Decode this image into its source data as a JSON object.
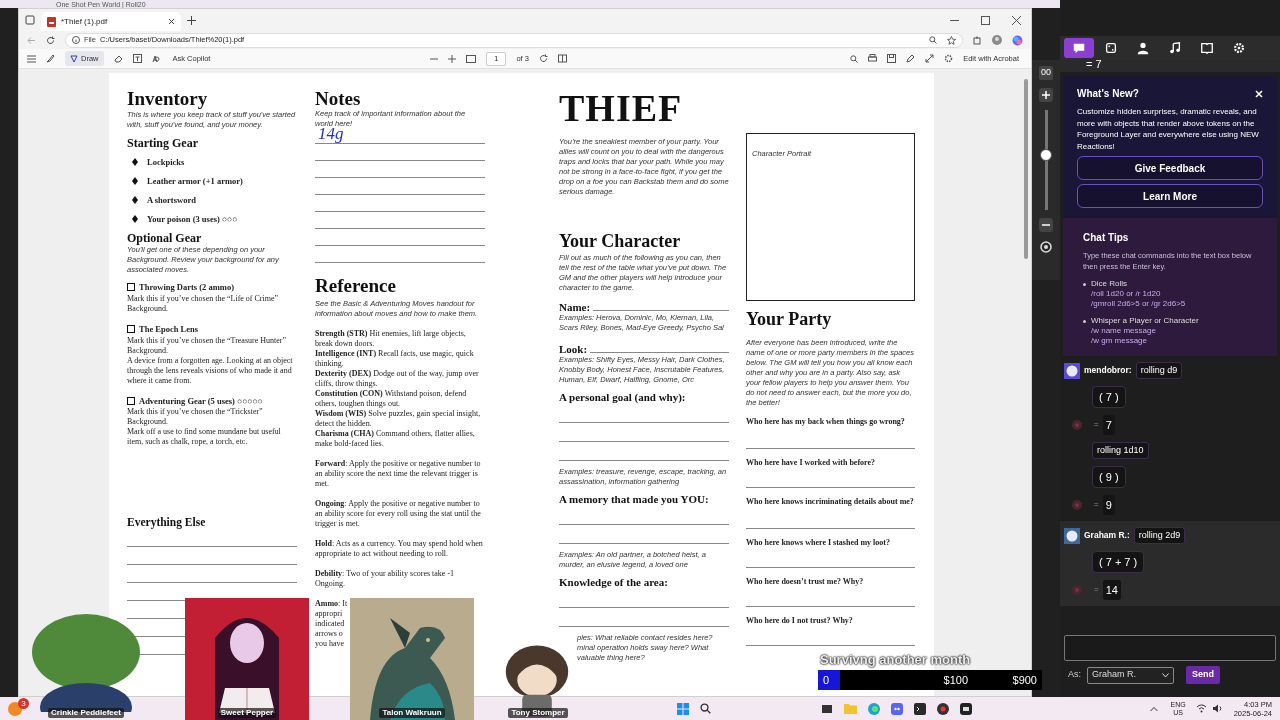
{
  "back_window": {
    "tab_title": "One Shot Pen World | Roll20"
  },
  "browser": {
    "tab_title": "*Thief (1).pdf",
    "address_label": "File",
    "address": "C:/Users/baset/Downloads/Thief%20(1).pdf"
  },
  "pdf_toolbar": {
    "draw_label": "Draw",
    "copilot_label": "Ask Copilot",
    "page": "1",
    "page_count": "of 3",
    "acrobat_label": "Edit with Acrobat"
  },
  "inventory": {
    "title": "Inventory",
    "intro": "This is where you keep track of stuff you've started with, stuff you've found, and your money.",
    "starting_title": "Starting Gear",
    "starting_items": [
      "Lockpicks",
      "Leather armor (+1 armor)",
      "A shortsword",
      "Your poison (3 uses) ○○○"
    ],
    "optional_title": "Optional Gear",
    "optional_intro": "You'll get one of these depending on your Background. Review your background for any associated moves.",
    "optional_items": [
      {
        "name": "Throwing Darts (2 ammo)",
        "checked": false,
        "text": [
          "Mark this if you’ve chosen the “Life of Crime” Background."
        ]
      },
      {
        "name": "The Epoch Lens",
        "checked": false,
        "text": [
          "Mark this if you’ve chosen the “Treasure Hunter” Background.",
          "A device from a forgotten age. Looking at an object through the lens reveals visions of who made it and where it came from."
        ]
      },
      {
        "name": "Adventuring Gear (5 uses) ○○○○○",
        "checked": false,
        "text": [
          "Mark this if you’ve chosen the “Trickster” Background.",
          "Mark off a use to find some mundane but useful item, such as chalk, rope, a torch, etc."
        ]
      }
    ],
    "else_title": "Everything Else"
  },
  "notes": {
    "title": "Notes",
    "intro": "Keep track of important information about the world here!",
    "handwriting": "14g"
  },
  "reference": {
    "title": "Reference",
    "intro": "See the Basic & Adventuring Moves handout for information about moves and how to make them.",
    "stats": [
      "**Strength (STR)** Hit enemies, lift large objects, break down doors.",
      "**Intelligence (INT)** Recall facts, use magic, quick thinking.",
      "**Dexterity (DEX)** Dodge out of the way, jump over cliffs, throw things.",
      "**Constitution (CON)** Withstand poison, defend others, toughen things out.",
      "**Wisdom (WIS)** Solve puzzles, gain special insight, detect the hidden.",
      "**Charisma (CHA)** Command others, flatter allies, make bold-faced lies."
    ],
    "terms": [
      "**Forward**: Apply the positive or negative number to an ability score the next time the relevant trigger is met.",
      "**Ongoing**: Apply the positive or negative number to an ability score for every roll using the stat until the trigger is met.",
      "**Hold**: Acts as a currency. You may spend hold when appropriate to act without needing to roll.",
      "**Debility**: Two of your ability scores take -1 Ongoing."
    ],
    "ammo_lines": [
      "**Ammo**: It",
      "appropri",
      "indicated",
      "arrows o",
      "you have"
    ]
  },
  "character": {
    "title": "THIEF",
    "intro": "You’re the sneakiest member of your party. Your allies will count on you to deal with the dangerous traps and locks that bar your path. While you may not be strong in a face-to-face fight, if you get the drop on a foe you can Backstab them and do some serious damage.",
    "section_title": "Your Character",
    "section_intro": "Fill out as much of the following as you can, then tell the rest of the table what you’ve put down. The GM and the other players will help introduce your character to the game.",
    "fields": [
      {
        "kind": "inline",
        "label": "Name:",
        "examples": [
          "Examples: Herova, Dominic, Mo, Kiernan, Lila, Scars Riley, Bones, Mad-Eye Greedy, Psycho Sal"
        ]
      },
      {
        "kind": "inline",
        "label": "Look:",
        "examples": [
          "Examples: Shifty Eyes, Messy Hair, Dark Clothes, Knobby Body, Honest Face, Inscrutable Features, Human, Elf, Dwarf, Halfling, Gnome, Orc"
        ]
      },
      {
        "kind": "long",
        "label": "A personal goal (and why):",
        "examples": [
          "Examples: treasure, revenge, escape, tracking, an assassination, information gathering"
        ]
      },
      {
        "kind": "short",
        "label": "A memory that made you YOU:",
        "examples": [
          "Examples: An old partner, a botched heist, a murder, an elusive legend, a loved one"
        ]
      },
      {
        "kind": "short",
        "label": "Knowledge of the area:",
        "examples": [
          "ples: What reliable contact resides here?",
          "minal operation holds sway here? What",
          "valuable thing here?"
        ]
      }
    ]
  },
  "party": {
    "portrait_label": "Character Portrait",
    "title": "Your Party",
    "intro": "After everyone has been introduced, write the name of one or more party members in the spaces below. The GM will tell you how you all know each other and why you are in a party. Also say, ask your fellow players to help you answer them. You do not need to answer each, but the more you do, the better!",
    "questions": [
      "Who here has my back when things go wrong?",
      "Who here have I worked with before?",
      "Who here knows incriminating details about me?",
      "Who here knows where I stashed my loot?",
      "Who here doesn’t trust me? Why?",
      "Who here do I not trust? Why?"
    ]
  },
  "vtt": {
    "zoom": {
      "fragment": "00",
      "level": 0.55
    },
    "tools": [
      {
        "selected": true
      },
      {
        "selected": false
      },
      {
        "selected": false
      },
      {
        "selected": false
      },
      {
        "selected": false
      },
      {
        "selected": false
      }
    ],
    "top_fragment": "= 7",
    "whats_new": {
      "title": "What's New?",
      "text": "Customize hidden surprises, dramatic reveals, and more with objects that render above tokens on the Foreground Layer and everywhere else using NEW Reactions!",
      "buttons": [
        "Give Feedback",
        "Learn More"
      ]
    },
    "tips": {
      "title": "Chat Tips",
      "intro": "Type these chat commands into the text box below then press the Enter key.",
      "groups": [
        {
          "label": "Dice Rolls",
          "commands": [
            "/roll 1d20 or /r 1d20",
            "/gmroll 2d6>5 or /gr 2d6>5"
          ]
        },
        {
          "label": "Whisper a Player or Character",
          "commands": [
            "/w name message",
            "/w gm message"
          ]
        }
      ]
    },
    "messages": [
      {
        "who": "mendobror:",
        "highlight": false,
        "lines": [
          {
            "kind": "label",
            "text": "rolling d9"
          },
          {
            "kind": "dice",
            "text": "( 7 )"
          },
          {
            "kind": "result",
            "sign": "=",
            "text": "7"
          },
          {
            "kind": "label",
            "text": "rolling 1d10"
          },
          {
            "kind": "dice",
            "text": "( 9 )"
          },
          {
            "kind": "result",
            "sign": "=",
            "text": "9"
          }
        ]
      },
      {
        "who": "Graham R.:",
        "highlight": true,
        "lines": [
          {
            "kind": "label",
            "text": "rolling 2d9"
          },
          {
            "kind": "dice",
            "text": "( 7 + 7 )"
          },
          {
            "kind": "result",
            "sign": "=",
            "text": "14"
          }
        ]
      }
    ],
    "as_label": "As:",
    "speaker": "Graham R.",
    "send": "Send"
  },
  "stream": {
    "goal": {
      "title": "Survivng another month",
      "start": "0",
      "mid": "$100",
      "end": "$900",
      "level": 0.1
    },
    "avatars": [
      {
        "kind": "blob",
        "name": "Crinkle Peddlefeet"
      },
      {
        "kind": "card",
        "name": "Sweet Pepper"
      },
      {
        "kind": "picture",
        "name": "Talon Walkruun"
      },
      {
        "kind": "chibi",
        "name": "Tony Stomper"
      }
    ]
  },
  "taskbar": {
    "weather_badge": "3",
    "language": "ENG",
    "region": "US",
    "time": "4:03 PM",
    "date": "2025-06-24"
  }
}
